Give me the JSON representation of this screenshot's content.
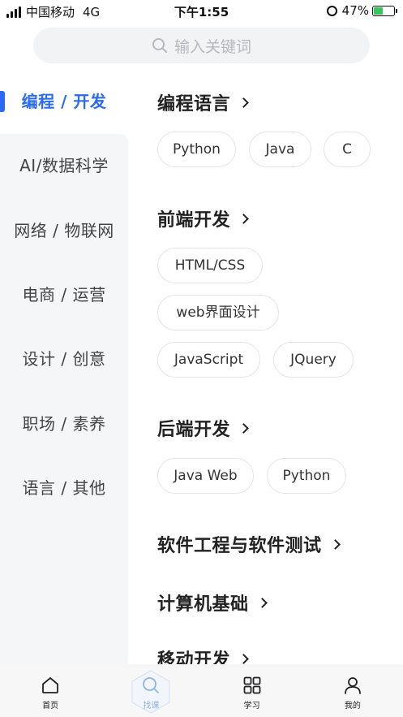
{
  "status_bar": {
    "carrier": "中国移动",
    "network": "4G",
    "time": "下午1:55",
    "battery": "47%",
    "battery_level": 0.47
  },
  "search": {
    "placeholder": "输入关键词"
  },
  "sidebar": {
    "items": [
      {
        "label": "编程 / 开发",
        "active": true
      },
      {
        "label": "AI/数据科学"
      },
      {
        "label": "网络 / 物联网"
      },
      {
        "label": "电商 / 运营"
      },
      {
        "label": "设计 / 创意"
      },
      {
        "label": "职场 / 素养"
      },
      {
        "label": "语言 / 其他"
      }
    ]
  },
  "sections": [
    {
      "title": "编程语言",
      "tags": [
        "Python",
        "Java",
        "C"
      ]
    },
    {
      "title": "前端开发",
      "tags": [
        "HTML/CSS",
        "web界面设计",
        "JavaScript",
        "JQuery"
      ]
    },
    {
      "title": "后端开发",
      "tags": [
        "Java Web",
        "Python"
      ]
    },
    {
      "title": "软件工程与软件测试",
      "tags": []
    },
    {
      "title": "计算机基础",
      "tags": []
    },
    {
      "title": "移动开发",
      "tags": []
    }
  ],
  "bottom_nav": {
    "items": [
      {
        "label": "首页",
        "icon": "home-icon"
      },
      {
        "label": "找课",
        "icon": "search-icon",
        "active": true
      },
      {
        "label": "学习",
        "icon": "grid-icon"
      },
      {
        "label": "我的",
        "icon": "user-icon"
      }
    ]
  },
  "colors": {
    "accent": "#2b6bf3",
    "sidebar_bg": "#f5f6f7",
    "nav_active": "#8fb3e0"
  }
}
